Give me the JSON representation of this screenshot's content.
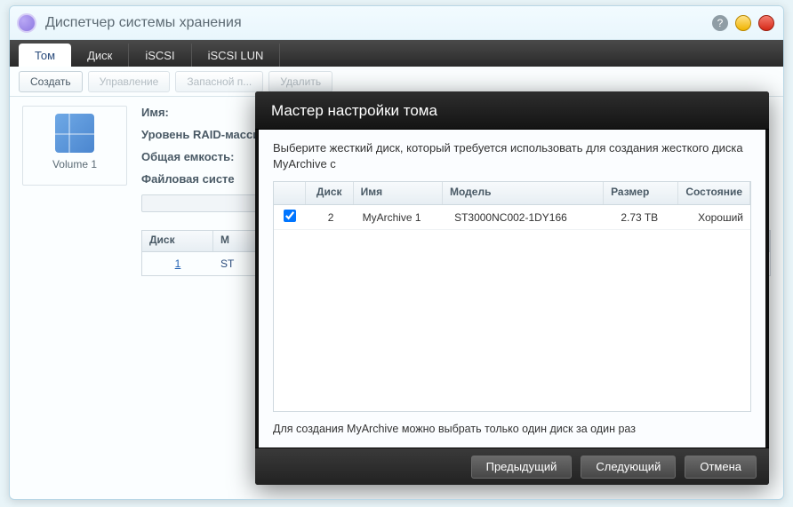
{
  "window_title": "Диспетчер системы хранения",
  "tabs": [
    "Том",
    "Диск",
    "iSCSI",
    "iSCSI LUN"
  ],
  "active_tab_index": 0,
  "toolbar": {
    "create": "Создать",
    "manage": "Управление",
    "spare": "Запасной п...",
    "delete": "Удалить"
  },
  "sidebar": {
    "volume_label": "Volume 1"
  },
  "detail": {
    "name_label": "Имя:",
    "raid_label": "Уровень RAID-массива:",
    "capacity_label": "Общая емкость:",
    "fs_label": "Файловая систе",
    "disk_table": {
      "headers": {
        "disk": "Диск",
        "m": "М"
      },
      "row": {
        "disk": "1",
        "m": "ST"
      }
    }
  },
  "modal": {
    "title": "Мастер настройки тома",
    "instruction": "Выберите жесткий диск, который требуется использовать для создания жесткого диска MyArchive с",
    "headers": {
      "disk": "Диск",
      "name": "Имя",
      "model": "Модель",
      "size": "Размер",
      "state": "Состояние"
    },
    "row": {
      "checked": true,
      "disk": "2",
      "name": "MyArchive 1",
      "model": "ST3000NC002-1DY166",
      "size": "2.73 TB",
      "state": "Хороший"
    },
    "note": "Для создания MyArchive можно выбрать только один диск за один раз",
    "buttons": {
      "prev": "Предыдущий",
      "next": "Следующий",
      "cancel": "Отмена"
    }
  }
}
